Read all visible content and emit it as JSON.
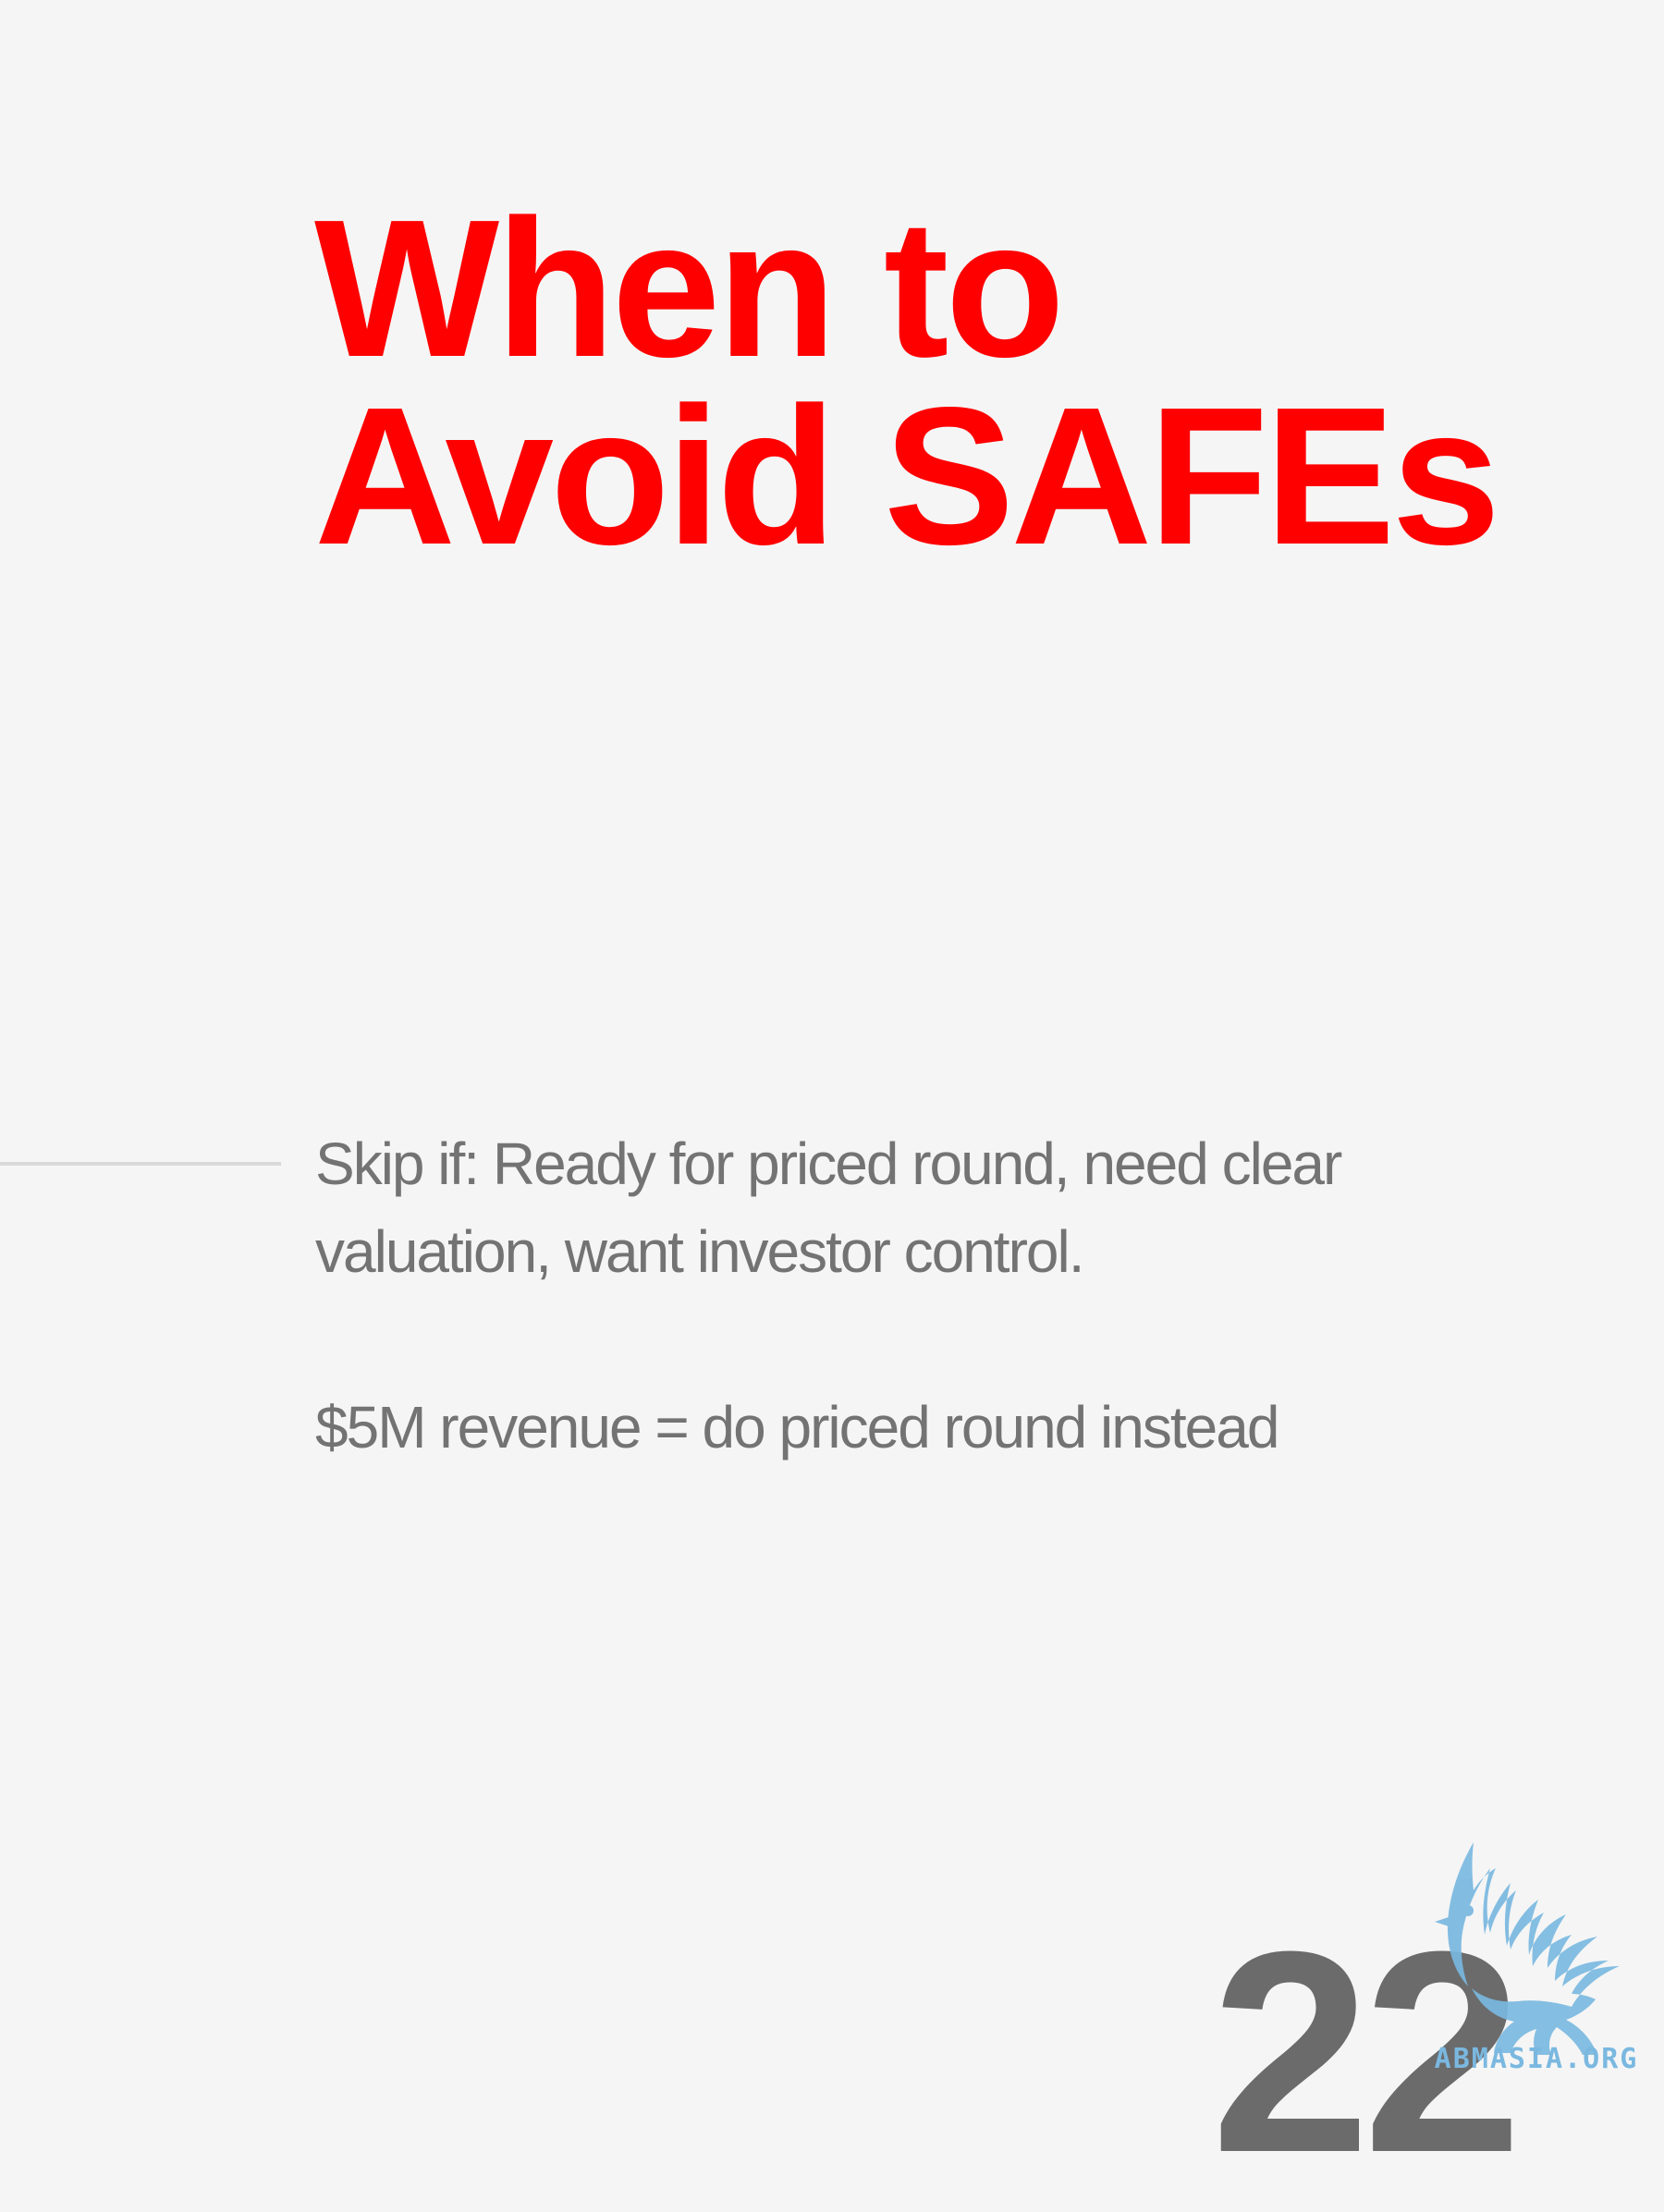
{
  "slide": {
    "title_line1": "When to",
    "title_line2": "Avoid SAFEs",
    "body_line1": "Skip if: Ready for priced round, need clear",
    "body_line2": "valuation, want investor control.",
    "body_line3": "$5M revenue = do priced round instead",
    "page_number": "22"
  },
  "logo": {
    "icon": "griffin-logo-icon",
    "text": "ABMASIA.ORG"
  },
  "colors": {
    "background": "#f5f5f5",
    "title": "#ff0000",
    "body": "#737373",
    "page_number": "#6b6b6b",
    "logo": "#7ab8e0"
  }
}
